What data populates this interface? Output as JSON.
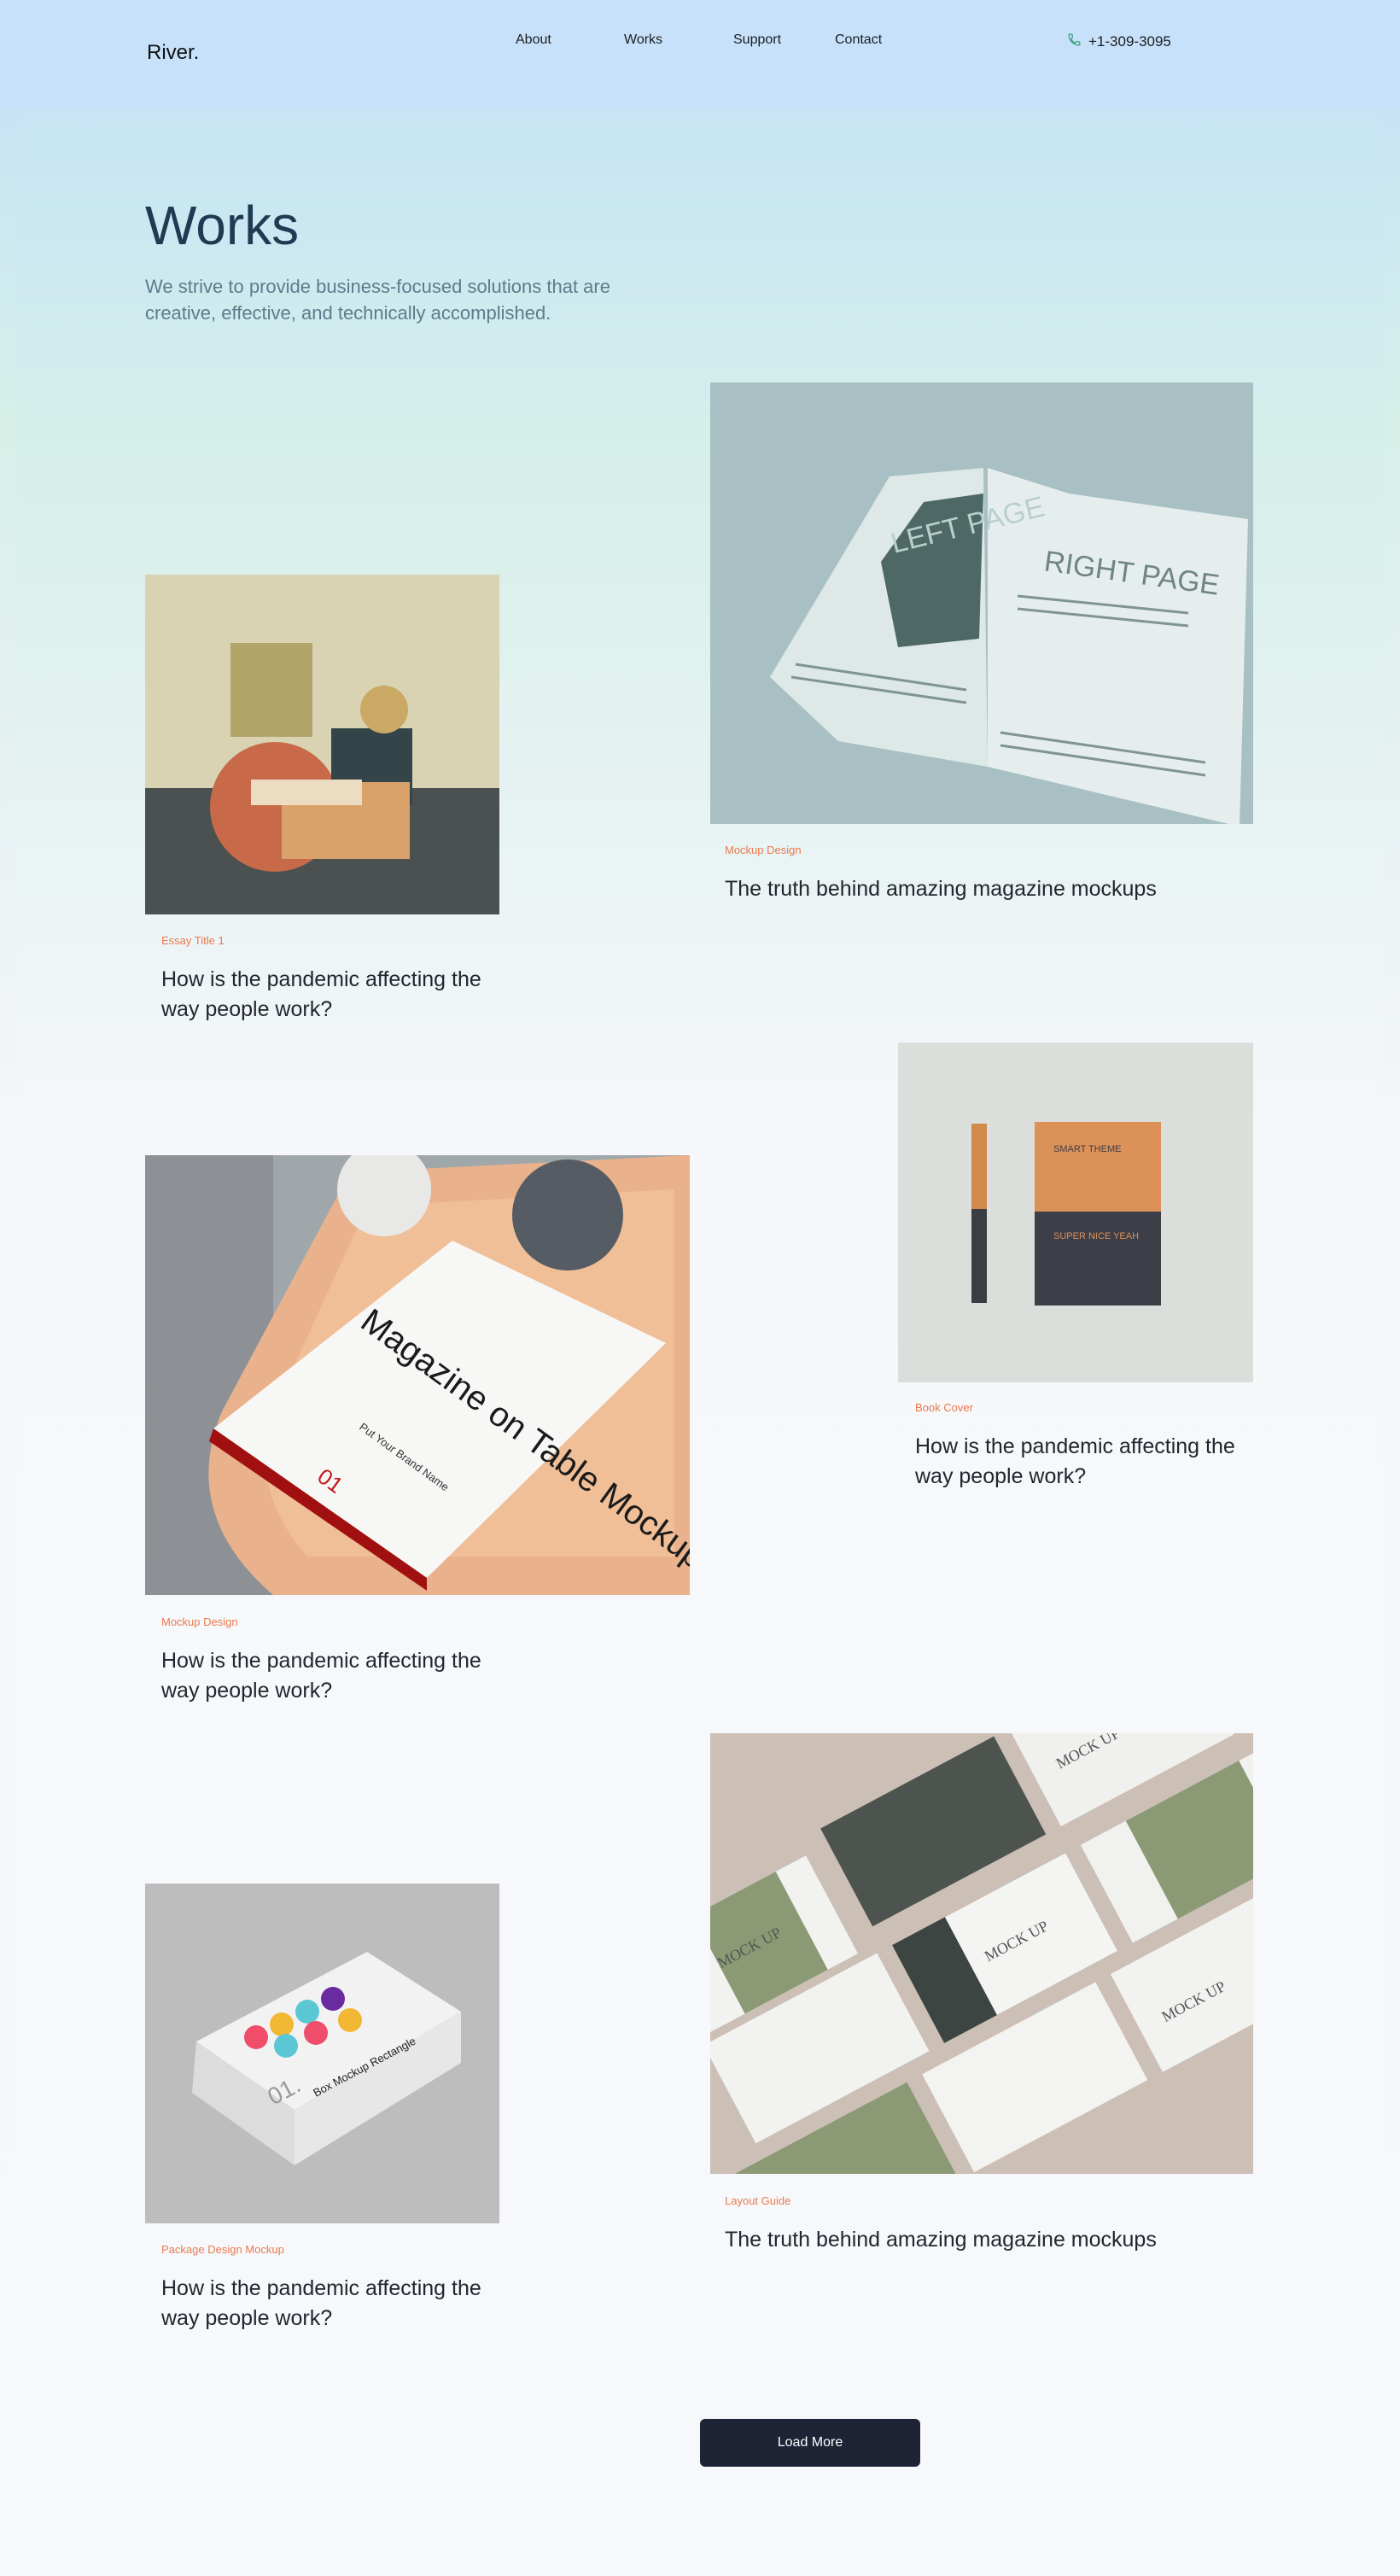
{
  "header": {
    "logo": "River.",
    "nav": [
      "About",
      "Works",
      "Support",
      "Contact"
    ],
    "phone": "+1-309-3095"
  },
  "hero": {
    "title": "Works",
    "subtitle": "We strive to provide business-focused solutions that are creative, effective, and technically accomplished."
  },
  "works": [
    {
      "tag": "Essay Title 1",
      "title": "How is the pandemic affecting the way people work?"
    },
    {
      "tag": "Mockup Design",
      "title": "The truth behind amazing magazine mockups"
    },
    {
      "tag": "Mockup Design",
      "title": "How is the pandemic affecting the way people work?"
    },
    {
      "tag": "Book Cover",
      "title": "How is the pandemic affecting the way people work?"
    },
    {
      "tag": "Package Design Mockup",
      "title": "How is the pandemic affecting the way people work?"
    },
    {
      "tag": "Layout Guide",
      "title": "The truth behind amazing magazine mockups"
    }
  ],
  "image_text": {
    "book_left": "LEFT PAGE",
    "book_right": "RIGHT PAGE",
    "magazine_title": "Magazine on Table Mockup",
    "magazine_sub": "Put Your Brand Name",
    "magazine_number": "01",
    "cover_top": "SMART THEME",
    "cover_bottom": "SUPER NICE YEAH",
    "box_label": "Box Mockup Rectangle",
    "box_number": "01.",
    "mock_up": "MOCK UP"
  },
  "load_more": "Load More",
  "colors": {
    "accent": "#ea7a4e",
    "title": "#1f3b52",
    "button": "#1e2436"
  }
}
